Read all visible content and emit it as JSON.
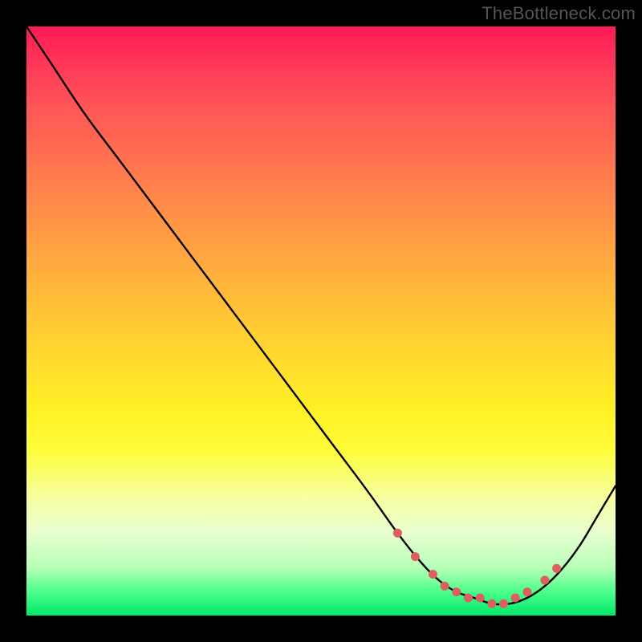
{
  "watermark": "TheBottleneck.com",
  "chart_data": {
    "type": "line",
    "title": "",
    "xlabel": "",
    "ylabel": "",
    "xlim": [
      0,
      100
    ],
    "ylim": [
      0,
      100
    ],
    "grid": false,
    "series": [
      {
        "name": "curve",
        "x": [
          0,
          4,
          10,
          16,
          22,
          28,
          34,
          40,
          46,
          52,
          58,
          63,
          67,
          70,
          73,
          76,
          79,
          82,
          85,
          88,
          91,
          94,
          97,
          100
        ],
        "y": [
          100,
          94,
          85,
          77,
          69,
          61,
          53,
          45,
          37,
          29,
          21,
          14,
          9,
          6,
          4,
          3,
          2,
          2,
          3,
          5,
          8,
          12,
          17,
          22
        ]
      }
    ],
    "highlight_points": {
      "comment": "salmon dots near the trough",
      "x": [
        63,
        66,
        69,
        71,
        73,
        75,
        77,
        79,
        81,
        83,
        85,
        88,
        90
      ],
      "y": [
        14,
        10,
        7,
        5,
        4,
        3,
        3,
        2,
        2,
        3,
        4,
        6,
        8
      ]
    },
    "colors": {
      "curve": "#000000",
      "dots": "#dc6060",
      "gradient_top": "#ff1a55",
      "gradient_bottom": "#00e86a"
    }
  }
}
